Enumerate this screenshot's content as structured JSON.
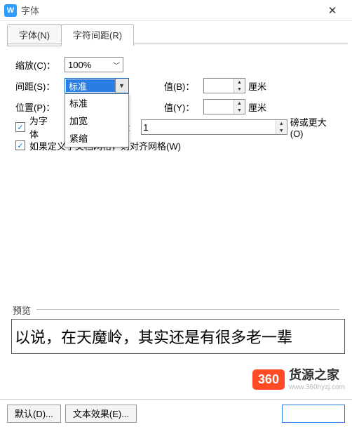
{
  "window": {
    "title": "字体",
    "close": "✕"
  },
  "tabs": {
    "font": "字体(N)",
    "spacing": "字符间距(R)"
  },
  "form": {
    "scale_label": "缩放(C)：",
    "scale_value": "100%",
    "spacing_label": "间距(S)：",
    "spacing_value": "标准",
    "spacing_options": {
      "0": "标准",
      "1": "加宽",
      "2": "紧缩"
    },
    "position_label": "位置(P)：",
    "value_b_label": "值(B)：",
    "value_y_label": "值(Y)：",
    "unit_cm": "厘米",
    "kerning_check": "为字体",
    "kerning_suffix": ")：",
    "kerning_value": "1",
    "kerning_unit": "磅或更大(O)",
    "grid_check": "如果定义了文档网格，则对齐网格(W)"
  },
  "preview": {
    "label": "预览",
    "text": "以说，在天魔岭，其实还是有很多老一辈"
  },
  "watermark": {
    "badge": "360",
    "main": "货源之家",
    "sub": "www.360hyzj.com"
  },
  "buttons": {
    "default": "默认(D)...",
    "effects": "文本效果(E)..."
  }
}
